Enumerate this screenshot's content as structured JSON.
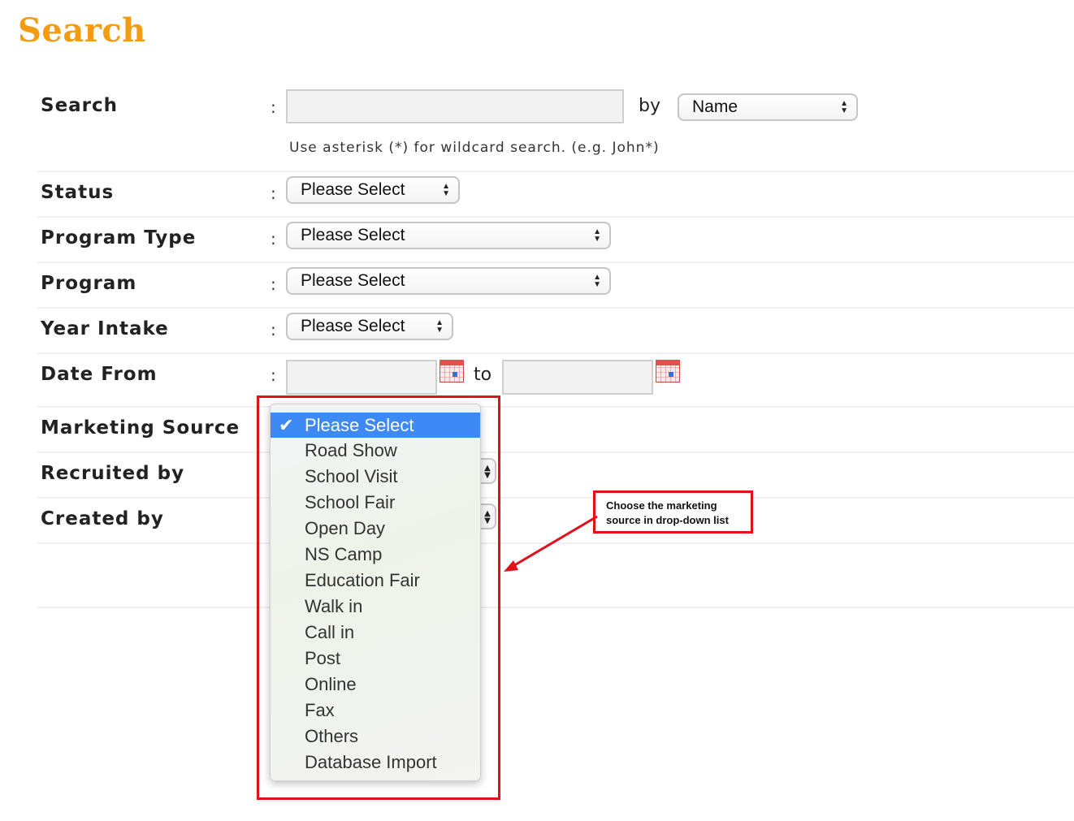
{
  "page": {
    "title": "Search"
  },
  "form": {
    "search": {
      "label": "Search",
      "value": "",
      "by_label": "by",
      "by_selected": "Name",
      "hint": "Use asterisk (*) for wildcard search. (e.g. John*)"
    },
    "status": {
      "label": "Status",
      "selected": "Please Select"
    },
    "program_type": {
      "label": "Program Type",
      "selected": "Please Select"
    },
    "program": {
      "label": "Program",
      "selected": "Please Select"
    },
    "year_intake": {
      "label": "Year Intake",
      "selected": "Please Select"
    },
    "date_from": {
      "label": "Date From",
      "from_value": "",
      "to_label": "to",
      "to_value": ""
    },
    "marketing_source": {
      "label": "Marketing Source"
    },
    "recruited_by": {
      "label": "Recruited by"
    },
    "created_by": {
      "label": "Created by"
    },
    "colon": ":"
  },
  "dropdown": {
    "selected_index": 0,
    "options": [
      "Please Select",
      "Road Show",
      "School Visit",
      "School Fair",
      "Open Day",
      "NS Camp",
      "Education Fair",
      "Walk in",
      "Call in",
      "Post",
      "Online",
      "Fax",
      "Others",
      "Database Import"
    ]
  },
  "annotation": {
    "line1": "Choose the marketing",
    "line2": "source in drop-down list",
    "color": "#e0111a"
  },
  "theme": {
    "title_color": "#f39c12",
    "selection_color": "#3d8af7"
  },
  "icons": {
    "select_arrows": "up-down-arrows-icon",
    "calendar": "calendar-icon",
    "check": "checkmark-icon"
  }
}
